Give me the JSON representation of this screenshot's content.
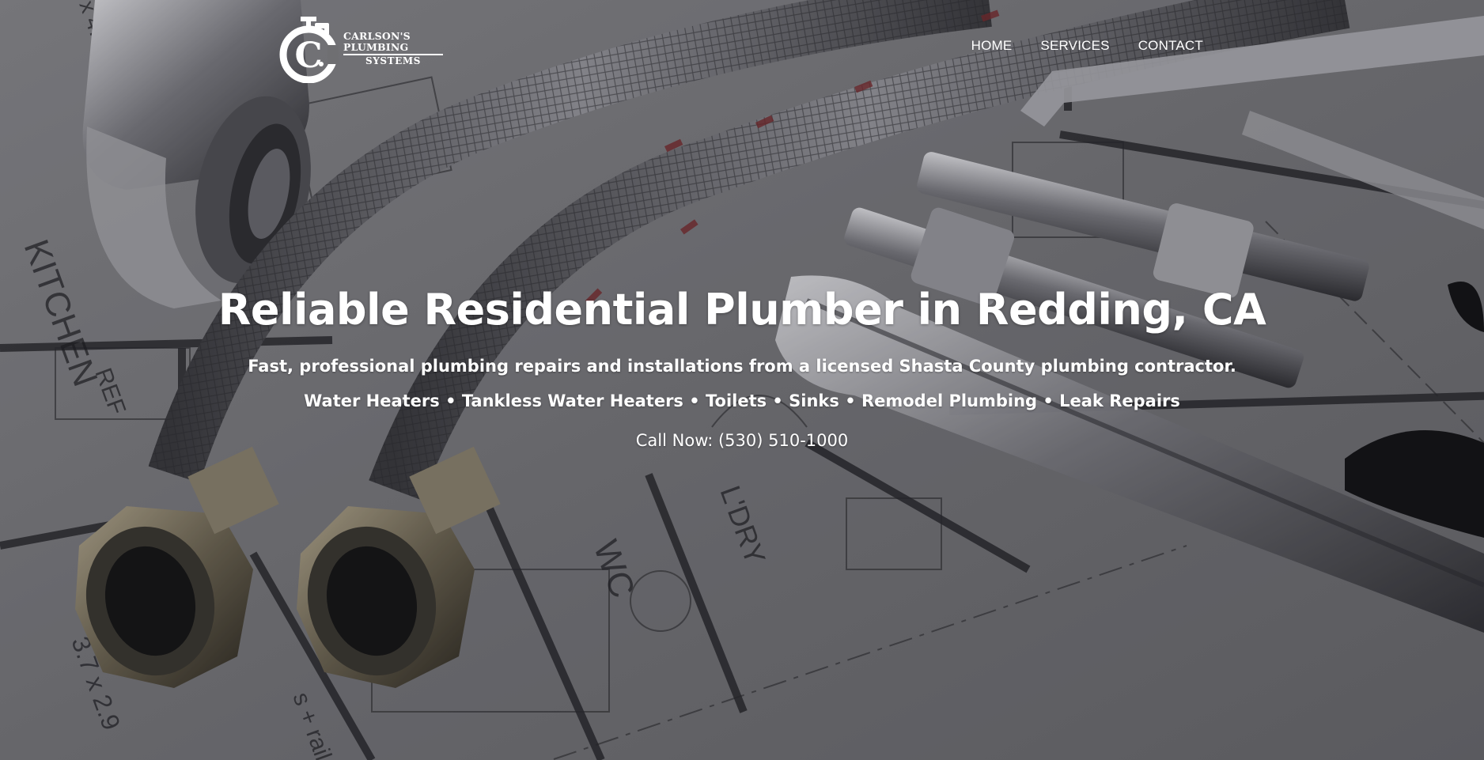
{
  "brand": {
    "logo_name_line1": "CARLSON'S PLUMBING",
    "logo_name_line2": "SYSTEMS",
    "logo_letter": "C"
  },
  "nav": {
    "items": [
      {
        "label": "HOME"
      },
      {
        "label": "SERVICES"
      },
      {
        "label": "CONTACT"
      }
    ]
  },
  "hero": {
    "title": "Reliable Residential Plumber in Redding, CA",
    "subtitle": "Fast, professional plumbing repairs and installations from a licensed Shasta County plumbing contractor.",
    "services_line": "Water Heaters • Tankless Water Heaters • Toilets • Sinks • Remodel Plumbing • Leak Repairs",
    "call_to_action": "Call Now: (530) 510-1000"
  },
  "colors": {
    "text": "#ffffff",
    "background_tint": "#6f6f72"
  }
}
